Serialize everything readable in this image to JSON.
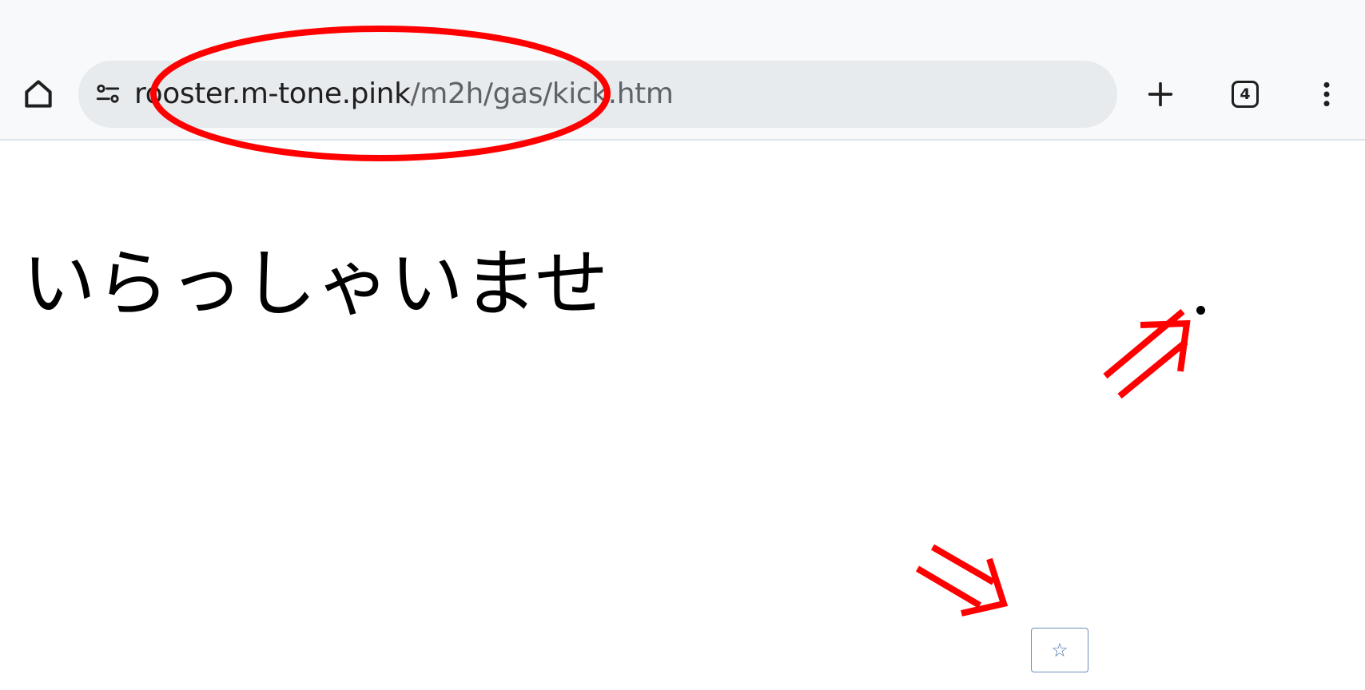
{
  "browser": {
    "url_host": "rooster.m-tone.pink",
    "url_path": "/m2h/gas/kick.htm",
    "tab_count": "4",
    "icons": {
      "home": "home-icon",
      "site_info": "tune-icon",
      "new_tab": "plus-icon",
      "tabs": "tab-switcher-icon",
      "menu": "more-vertical-icon"
    }
  },
  "page": {
    "heading": "いらっしゃいませ",
    "star_button_label": "☆"
  },
  "annotations": {
    "color": "#ff0000"
  }
}
